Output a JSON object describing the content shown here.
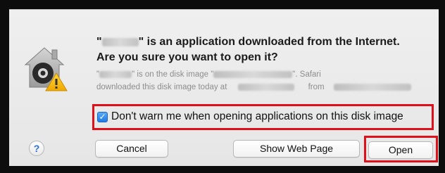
{
  "dialog": {
    "title_line1_prefix": "\"",
    "title_line1_suffix": "\" is an application downloaded from the Internet.",
    "title_line2": "Are you sure you want to open it?",
    "sub_line1_part1": "\"",
    "sub_line1_part2": "\" is on the disk image \"",
    "sub_line1_part3": "\". Safari",
    "sub_line2_part1": "downloaded this disk image today at",
    "sub_line2_part2": "from",
    "checkbox_label": "Don't warn me when opening applications on this disk image",
    "checkbox_checked": true,
    "help_label": "?",
    "buttons": {
      "cancel": "Cancel",
      "show_web_page": "Show Web Page",
      "open": "Open"
    }
  },
  "colors": {
    "highlight": "#e0101a",
    "checkbox_accent": "#1f7ae3",
    "dialog_bg": "#ececec"
  },
  "icons": {
    "gatekeeper": "gatekeeper-warning-icon",
    "checkmark": "checkmark-icon",
    "help": "help-icon"
  }
}
